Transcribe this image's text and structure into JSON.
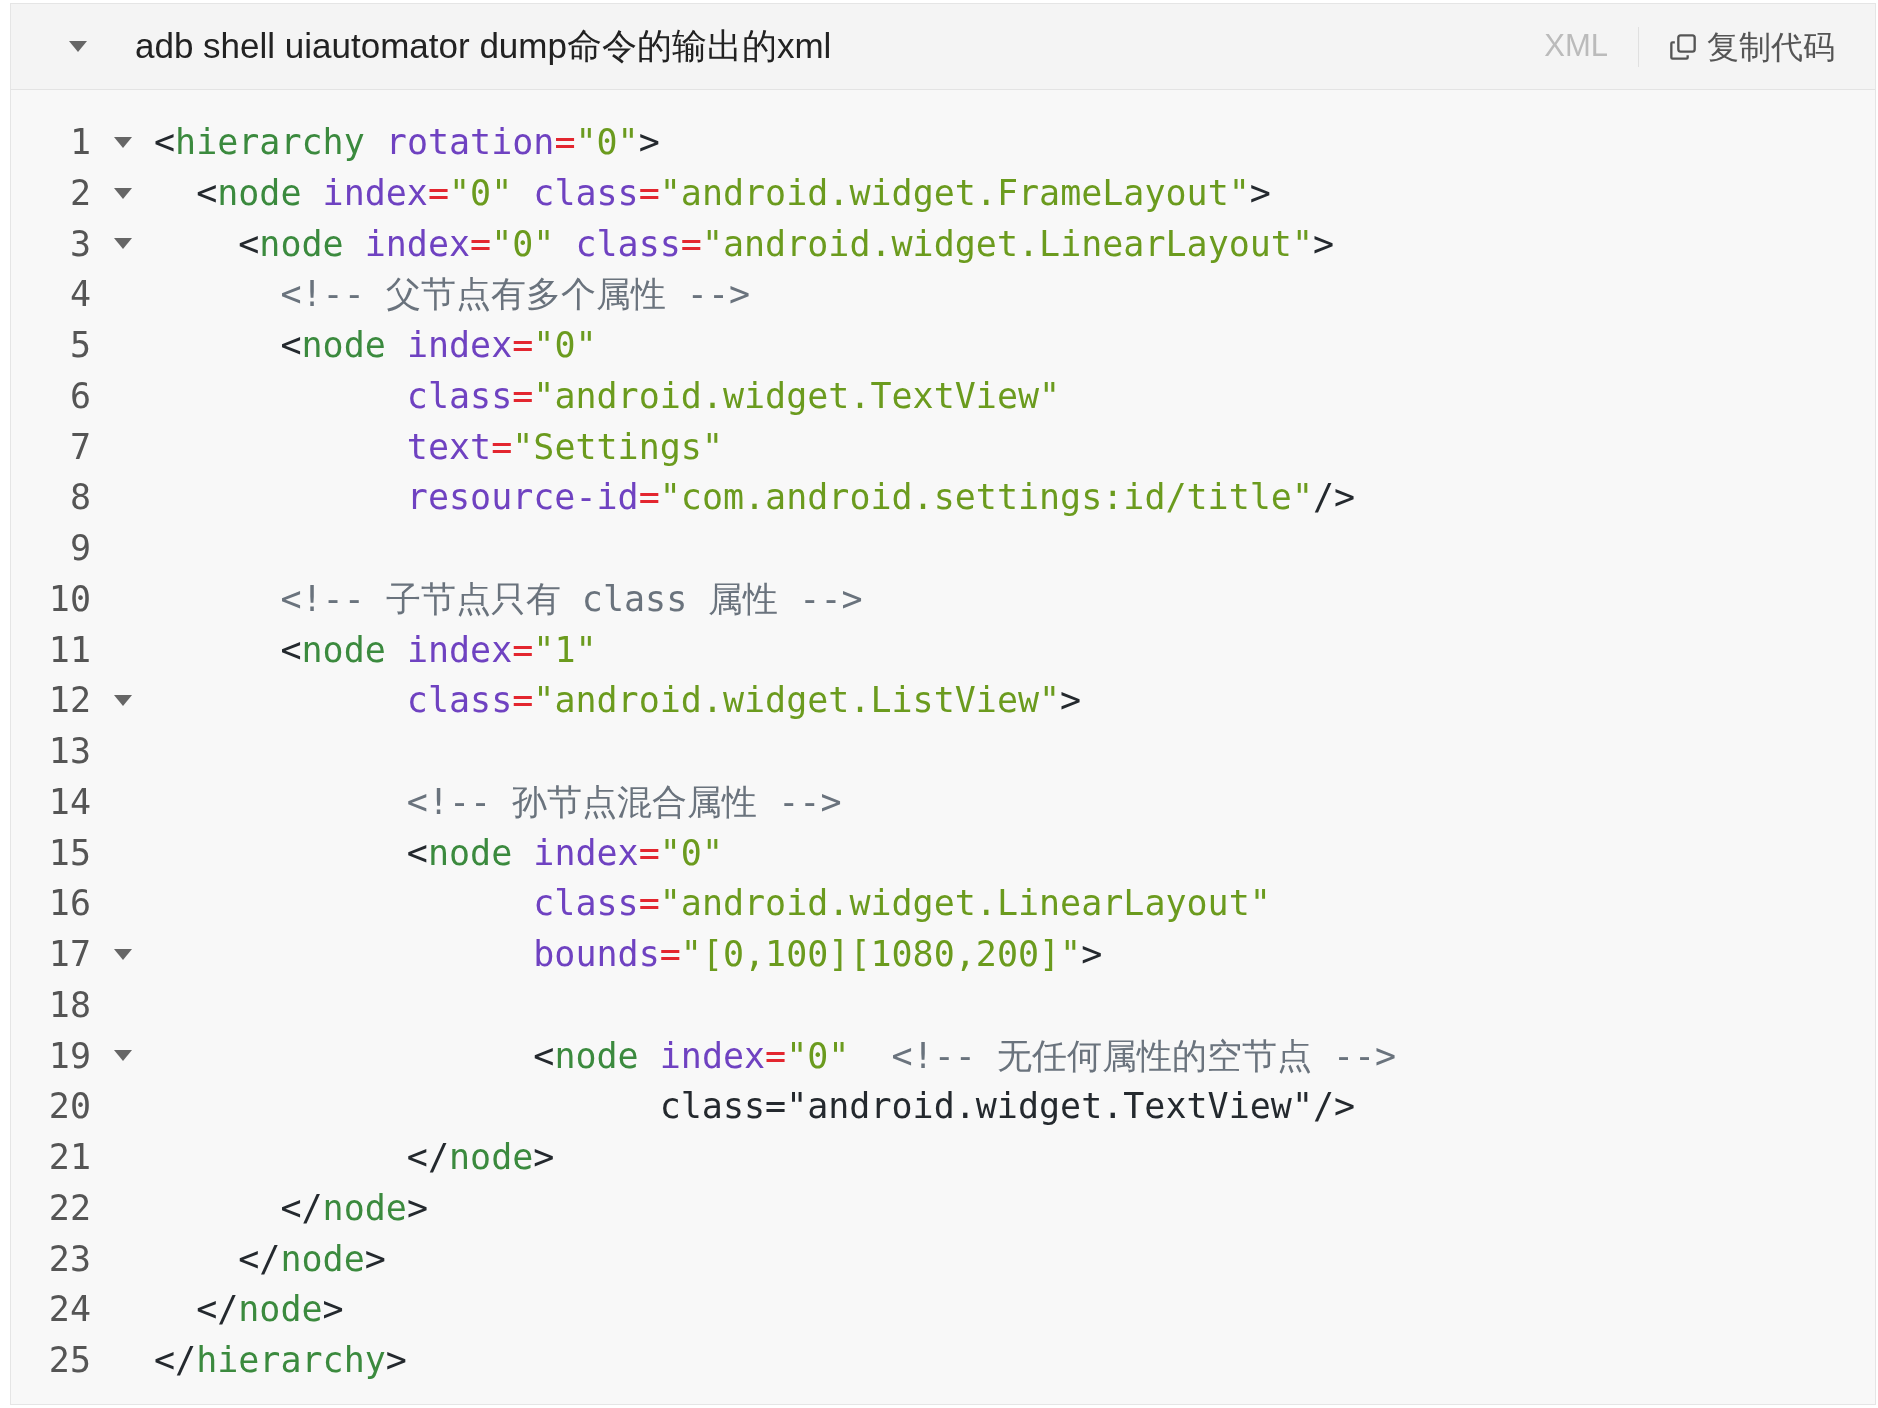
{
  "header": {
    "expanded": true,
    "title": "adb shell uiautomator dump命令的输出的xml",
    "language": "XML",
    "copy_button": "复制代码"
  },
  "lines": [
    {
      "number": "1",
      "foldable": true,
      "tokens": [
        {
          "kind": "punct",
          "text": "<"
        },
        {
          "kind": "tag",
          "text": "hierarchy"
        },
        {
          "kind": "attr",
          "text": " rotation"
        },
        {
          "kind": "eq",
          "text": "="
        },
        {
          "kind": "str",
          "text": "\"0\""
        },
        {
          "kind": "punct",
          "text": ">"
        }
      ]
    },
    {
      "number": "2",
      "foldable": true,
      "tokens": [
        {
          "kind": "punct",
          "text": "  <"
        },
        {
          "kind": "tag",
          "text": "node"
        },
        {
          "kind": "attr",
          "text": " index"
        },
        {
          "kind": "eq",
          "text": "="
        },
        {
          "kind": "str",
          "text": "\"0\""
        },
        {
          "kind": "attr",
          "text": " class"
        },
        {
          "kind": "eq",
          "text": "="
        },
        {
          "kind": "str",
          "text": "\"android.widget.FrameLayout\""
        },
        {
          "kind": "punct",
          "text": ">"
        }
      ]
    },
    {
      "number": "3",
      "foldable": true,
      "tokens": [
        {
          "kind": "punct",
          "text": "    <"
        },
        {
          "kind": "tag",
          "text": "node"
        },
        {
          "kind": "attr",
          "text": " index"
        },
        {
          "kind": "eq",
          "text": "="
        },
        {
          "kind": "str",
          "text": "\"0\""
        },
        {
          "kind": "attr",
          "text": " class"
        },
        {
          "kind": "eq",
          "text": "="
        },
        {
          "kind": "str",
          "text": "\"android.widget.LinearLayout\""
        },
        {
          "kind": "punct",
          "text": ">"
        }
      ]
    },
    {
      "number": "4",
      "foldable": false,
      "tokens": [
        {
          "kind": "comment",
          "text": "      <!-- 父节点有多个属性 -->"
        }
      ]
    },
    {
      "number": "5",
      "foldable": false,
      "tokens": [
        {
          "kind": "punct",
          "text": "      <"
        },
        {
          "kind": "tag",
          "text": "node"
        },
        {
          "kind": "attr",
          "text": " index"
        },
        {
          "kind": "eq",
          "text": "="
        },
        {
          "kind": "str",
          "text": "\"0\""
        }
      ]
    },
    {
      "number": "6",
      "foldable": false,
      "tokens": [
        {
          "kind": "attr",
          "text": "            class"
        },
        {
          "kind": "eq",
          "text": "="
        },
        {
          "kind": "str",
          "text": "\"android.widget.TextView\""
        }
      ]
    },
    {
      "number": "7",
      "foldable": false,
      "tokens": [
        {
          "kind": "attr",
          "text": "            text"
        },
        {
          "kind": "eq",
          "text": "="
        },
        {
          "kind": "str",
          "text": "\"Settings\""
        }
      ]
    },
    {
      "number": "8",
      "foldable": false,
      "tokens": [
        {
          "kind": "attr",
          "text": "            resource-id"
        },
        {
          "kind": "eq",
          "text": "="
        },
        {
          "kind": "str",
          "text": "\"com.android.settings:id/title\""
        },
        {
          "kind": "punct",
          "text": "/>"
        }
      ]
    },
    {
      "number": "9",
      "foldable": false
    },
    {
      "number": "10",
      "foldable": false,
      "tokens": [
        {
          "kind": "comment",
          "text": "      <!-- 子节点只有 class 属性 -->"
        }
      ]
    },
    {
      "number": "11",
      "foldable": false,
      "tokens": [
        {
          "kind": "punct",
          "text": "      <"
        },
        {
          "kind": "tag",
          "text": "node"
        },
        {
          "kind": "attr",
          "text": " index"
        },
        {
          "kind": "eq",
          "text": "="
        },
        {
          "kind": "str",
          "text": "\"1\""
        }
      ]
    },
    {
      "number": "12",
      "foldable": true,
      "tokens": [
        {
          "kind": "attr",
          "text": "            class"
        },
        {
          "kind": "eq",
          "text": "="
        },
        {
          "kind": "str",
          "text": "\"android.widget.ListView\""
        },
        {
          "kind": "punct",
          "text": ">"
        }
      ]
    },
    {
      "number": "13",
      "foldable": false
    },
    {
      "number": "14",
      "foldable": false,
      "tokens": [
        {
          "kind": "comment",
          "text": "            <!-- 孙节点混合属性 -->"
        }
      ]
    },
    {
      "number": "15",
      "foldable": false,
      "tokens": [
        {
          "kind": "punct",
          "text": "            <"
        },
        {
          "kind": "tag",
          "text": "node"
        },
        {
          "kind": "attr",
          "text": " index"
        },
        {
          "kind": "eq",
          "text": "="
        },
        {
          "kind": "str",
          "text": "\"0\""
        }
      ]
    },
    {
      "number": "16",
      "foldable": false,
      "tokens": [
        {
          "kind": "attr",
          "text": "                  class"
        },
        {
          "kind": "eq",
          "text": "="
        },
        {
          "kind": "str",
          "text": "\"android.widget.LinearLayout\""
        }
      ]
    },
    {
      "number": "17",
      "foldable": true,
      "tokens": [
        {
          "kind": "attr",
          "text": "                  bounds"
        },
        {
          "kind": "eq",
          "text": "="
        },
        {
          "kind": "str",
          "text": "\"[0,100][1080,200]\""
        },
        {
          "kind": "punct",
          "text": ">"
        }
      ]
    },
    {
      "number": "18",
      "foldable": false
    },
    {
      "number": "19",
      "foldable": true,
      "tokens": [
        {
          "kind": "punct",
          "text": "                  <"
        },
        {
          "kind": "tag",
          "text": "node"
        },
        {
          "kind": "attr",
          "text": " index"
        },
        {
          "kind": "eq",
          "text": "="
        },
        {
          "kind": "str",
          "text": "\"0\""
        },
        {
          "kind": "comment",
          "text": "  <!-- 无任何属性的空节点 -->"
        }
      ]
    },
    {
      "number": "20",
      "foldable": false,
      "tokens": [
        {
          "kind": "punct",
          "text": "                        class=\"android.widget.TextView\"/>"
        }
      ]
    },
    {
      "number": "21",
      "foldable": false,
      "tokens": [
        {
          "kind": "punct",
          "text": "            </"
        },
        {
          "kind": "tag",
          "text": "node"
        },
        {
          "kind": "punct",
          "text": ">"
        }
      ]
    },
    {
      "number": "22",
      "foldable": false,
      "tokens": [
        {
          "kind": "punct",
          "text": "      </"
        },
        {
          "kind": "tag",
          "text": "node"
        },
        {
          "kind": "punct",
          "text": ">"
        }
      ]
    },
    {
      "number": "23",
      "foldable": false,
      "tokens": [
        {
          "kind": "punct",
          "text": "    </"
        },
        {
          "kind": "tag",
          "text": "node"
        },
        {
          "kind": "punct",
          "text": ">"
        }
      ]
    },
    {
      "number": "24",
      "foldable": false,
      "tokens": [
        {
          "kind": "punct",
          "text": "  </"
        },
        {
          "kind": "tag",
          "text": "node"
        },
        {
          "kind": "punct",
          "text": ">"
        }
      ]
    },
    {
      "number": "25",
      "foldable": false,
      "tokens": [
        {
          "kind": "punct",
          "text": "</"
        },
        {
          "kind": "tag",
          "text": "hierarchy"
        },
        {
          "kind": "punct",
          "text": ">"
        }
      ]
    }
  ]
}
